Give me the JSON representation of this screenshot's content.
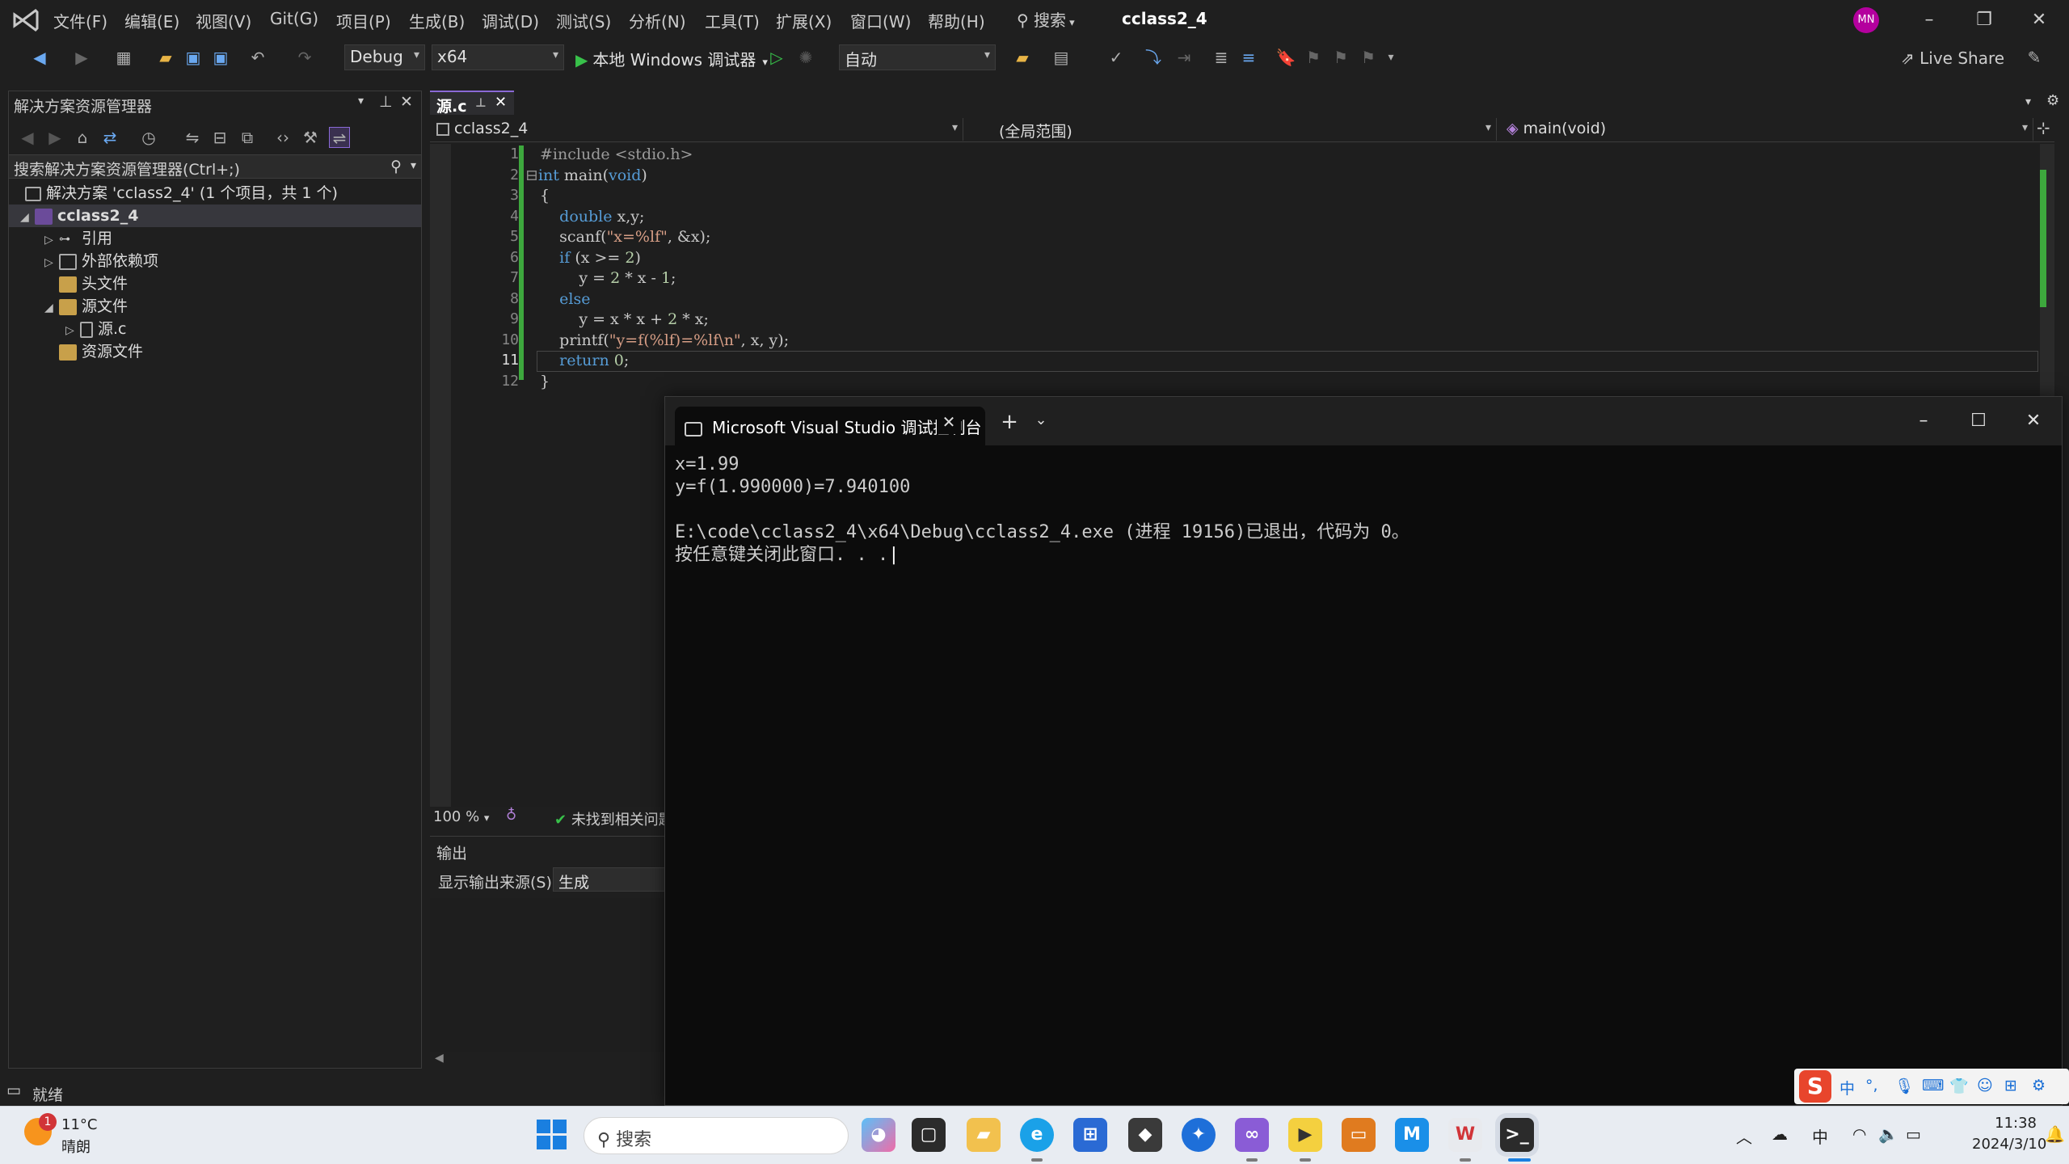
{
  "menu": {
    "items": [
      "文件(F)",
      "编辑(E)",
      "视图(V)",
      "Git(G)",
      "项目(P)",
      "生成(B)",
      "调试(D)",
      "测试(S)",
      "分析(N)",
      "工具(T)",
      "扩展(X)",
      "窗口(W)",
      "帮助(H)"
    ],
    "search": "搜索",
    "solution_title": "cclass2_4",
    "avatar": "MN"
  },
  "toolbar": {
    "config": "Debug",
    "platform": "x64",
    "run_label": "本地 Windows 调试器",
    "auto": "自动",
    "live_share": "Live Share"
  },
  "solution_explorer": {
    "title": "解决方案资源管理器",
    "search_placeholder": "搜索解决方案资源管理器(Ctrl+;)",
    "solution_row": "解决方案 'cclass2_4' (1 个项目，共 1 个)",
    "project": "cclass2_4",
    "nodes": [
      "引用",
      "外部依赖项",
      "头文件",
      "源文件",
      "源.c",
      "资源文件"
    ]
  },
  "editor": {
    "tab": "源.c",
    "nav_project": "cclass2_4",
    "nav_scope": "(全局范围)",
    "nav_member": "main(void)",
    "line_numbers": [
      "1",
      "2",
      "3",
      "4",
      "5",
      "6",
      "7",
      "8",
      "9",
      "10",
      "11",
      "12"
    ],
    "zoom": "100 %",
    "issues": "未找到相关问题"
  },
  "output": {
    "title": "输出",
    "source_label": "显示输出来源(S):",
    "source_value": "生成"
  },
  "statusbar": {
    "text": "就绪"
  },
  "console": {
    "tab_title": "Microsoft Visual Studio 调试控制台",
    "lines": [
      "x=1.99",
      "y=f(1.990000)=7.940100",
      "",
      "E:\\code\\cclass2_4\\x64\\Debug\\cclass2_4.exe (进程 19156)已退出，代码为 0。",
      "按任意键关闭此窗口. . ."
    ]
  },
  "taskbar": {
    "weather_badge": "1",
    "temp": "11°C",
    "condition": "晴朗",
    "search": "搜索",
    "time": "11:38",
    "date": "2024/3/10"
  }
}
